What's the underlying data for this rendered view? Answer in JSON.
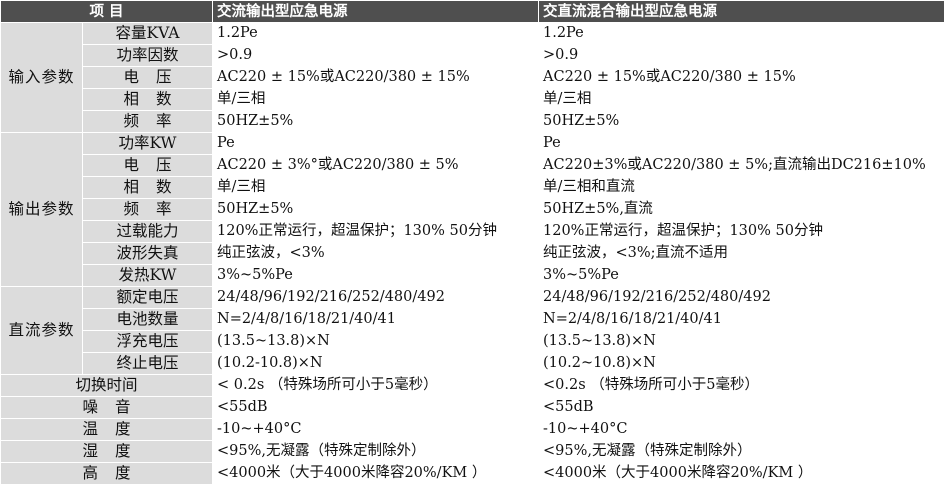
{
  "headers": {
    "item": "项  目",
    "col1": "交流输出型应急电源",
    "col2": "交直流混合输出型应急电源"
  },
  "groups": {
    "input": "输入参数",
    "output": "输出参数",
    "dc": "直流参数"
  },
  "input_rows": [
    {
      "label": "容量KVA",
      "v1": "1.2Pe",
      "v2": "1.2Pe"
    },
    {
      "label": "功率因数",
      "v1": ">0.9",
      "v2": ">0.9"
    },
    {
      "label": "电  压",
      "v1": "AC220 ± 15%或AC220/380 ± 15%",
      "v2": "AC220 ± 15%或AC220/380 ± 15%"
    },
    {
      "label": "相  数",
      "v1": "单/三相",
      "v2": "单/三相"
    },
    {
      "label": "频  率",
      "v1": "50HZ±5%",
      "v2": "50HZ±5%"
    }
  ],
  "output_rows": [
    {
      "label": "功率KW",
      "v1": "Pe",
      "v2": "Pe"
    },
    {
      "label": "电  压",
      "v1": "AC220 ± 3%°或AC220/380 ± 5%",
      "v2": "AC220±3%或AC220/380 ± 5%;直流输出DC216±10%"
    },
    {
      "label": "相  数",
      "v1": "单/三相",
      "v2": "单/三相和直流"
    },
    {
      "label": "频  率",
      "v1": "50HZ±5%",
      "v2": "50HZ±5%,直流"
    },
    {
      "label": "过载能力",
      "v1": "120%正常运行，超温保护；130% 50分钟",
      "v2": "120%正常运行，超温保护；130% 50分钟"
    },
    {
      "label": "波形失真",
      "v1": "纯正弦波，<3%",
      "v2": "纯正弦波，<3%;直流不适用"
    },
    {
      "label": "发热KW",
      "v1": "3%~5%Pe",
      "v2": "3%~5%Pe"
    }
  ],
  "dc_rows": [
    {
      "label": "额定电压",
      "v1": "24/48/96/192/216/252/480/492",
      "v2": "24/48/96/192/216/252/480/492"
    },
    {
      "label": "电池数量",
      "v1": "N=2/4/8/16/18/21/40/41",
      "v2": "N=2/4/8/16/18/21/40/41"
    },
    {
      "label": "浮充电压",
      "v1": "(13.5~13.8)×N",
      "v2": "(13.5~13.8)×N"
    },
    {
      "label": "终止电压",
      "v1": "(10.2-10.8)×N",
      "v2": "(10.2~10.8)×N"
    }
  ],
  "misc_rows": [
    {
      "label": "切换时间",
      "v1": "< 0.2s （特殊场所可小于5毫秒）",
      "v2": "<0.2s （特殊场所可小于5毫秒）"
    },
    {
      "label": "噪  音",
      "v1": "<55dB",
      "v2": "<55dB"
    },
    {
      "label": "温  度",
      "v1": "-10~+40°C",
      "v2": "-10~+40°C"
    },
    {
      "label": "湿  度",
      "v1": "<95%,无凝露（特殊定制除外）",
      "v2": "<95%,无凝露（特殊定制除外）"
    },
    {
      "label": "高  度",
      "v1": "<4000米（大于4000米降容20%/KM ）",
      "v2": "<4000米（大于4000米降容20%/KM ）"
    }
  ]
}
